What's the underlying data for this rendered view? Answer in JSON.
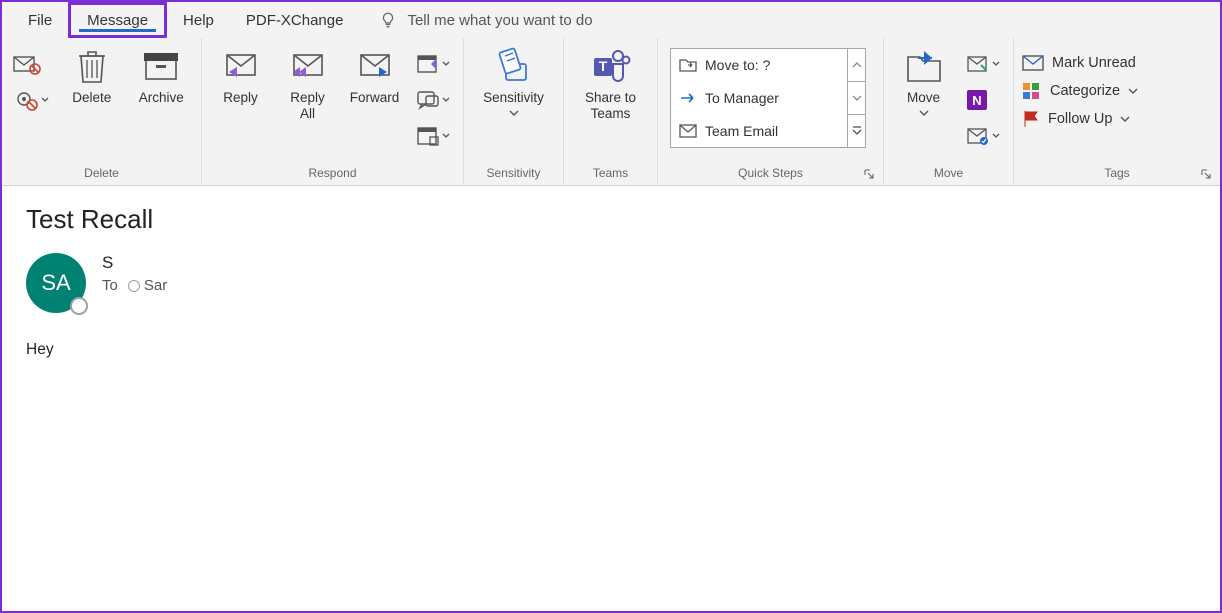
{
  "tabs": {
    "file": "File",
    "message": "Message",
    "help": "Help",
    "pdfx": "PDF-XChange"
  },
  "tellme": "Tell me what you want to do",
  "groups": {
    "delete": {
      "label": "Delete",
      "delete": "Delete",
      "archive": "Archive"
    },
    "respond": {
      "label": "Respond",
      "reply": "Reply",
      "replyall": "Reply\nAll",
      "forward": "Forward"
    },
    "sensitivity": {
      "label": "Sensitivity",
      "btn": "Sensitivity"
    },
    "teams": {
      "label": "Teams",
      "btn": "Share to\nTeams"
    },
    "quicksteps": {
      "label": "Quick Steps",
      "items": [
        "Move to: ?",
        "To Manager",
        "Team Email"
      ]
    },
    "move": {
      "label": "Move",
      "btn": "Move"
    },
    "tags": {
      "label": "Tags",
      "unread": "Mark Unread",
      "categorize": "Categorize",
      "followup": "Follow Up"
    }
  },
  "message": {
    "subject": "Test Recall",
    "avatar_initials": "SA",
    "from": "S",
    "to_label": "To",
    "to_name": "Sar",
    "body": "Hey"
  }
}
